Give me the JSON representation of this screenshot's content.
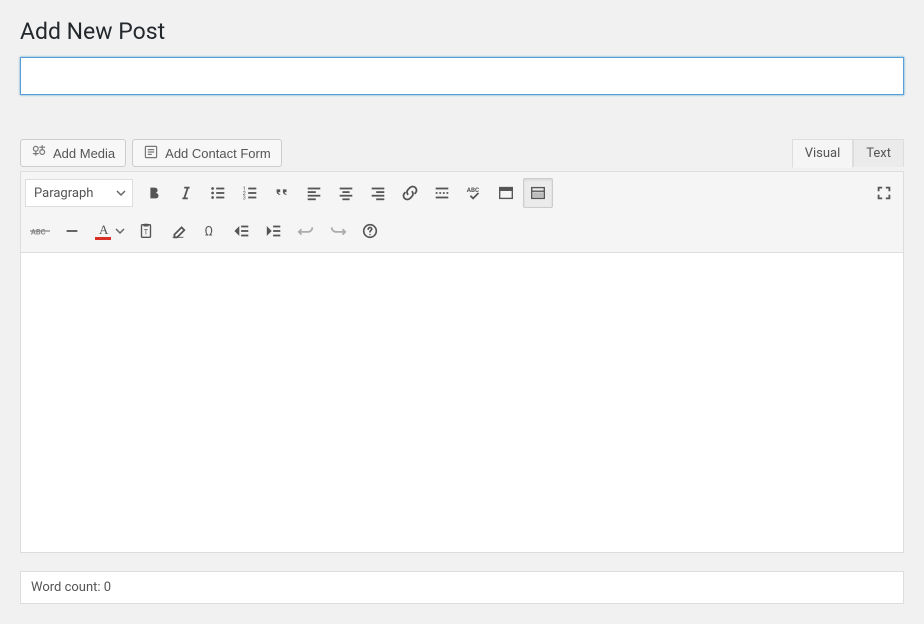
{
  "page": {
    "title": "Add New Post"
  },
  "title_field": {
    "value": "",
    "placeholder": ""
  },
  "media_buttons": {
    "add_media": "Add Media",
    "add_contact_form": "Add Contact Form"
  },
  "editor_tabs": {
    "visual": "Visual",
    "text": "Text",
    "active": "visual"
  },
  "format_dropdown": {
    "selected": "Paragraph"
  },
  "text_color": {
    "value": "#d93025"
  },
  "footer": {
    "word_count_label": "Word count: ",
    "word_count": 0
  }
}
